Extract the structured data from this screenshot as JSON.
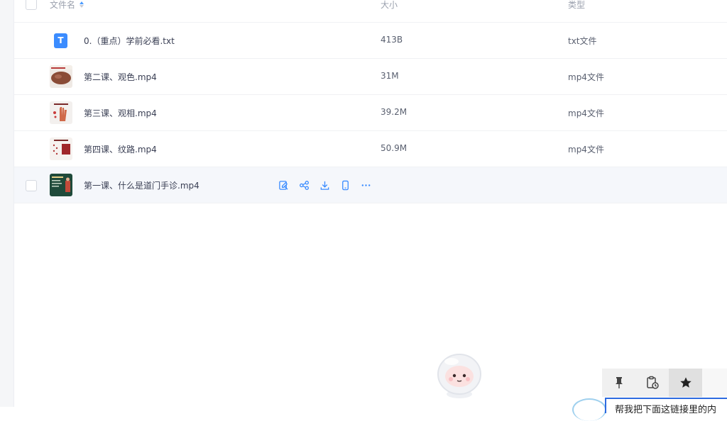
{
  "header": {
    "name_label": "文件名",
    "size_label": "大小",
    "type_label": "类型"
  },
  "files": [
    {
      "name": "0.（重点）学前必看.txt",
      "size": "413B",
      "type": "txt文件",
      "icon": "txt-file-icon",
      "icon_letter": "T"
    },
    {
      "name": "第二课、观色.mp4",
      "size": "31M",
      "type": "mp4文件",
      "icon": "video-thumbnail"
    },
    {
      "name": "第三课、观相.mp4",
      "size": "39.2M",
      "type": "mp4文件",
      "icon": "video-thumbnail"
    },
    {
      "name": "第四课、纹路.mp4",
      "size": "50.9M",
      "type": "mp4文件",
      "icon": "video-thumbnail"
    },
    {
      "name": "第一课、什么是道门手诊.mp4",
      "size": "",
      "type": "",
      "icon": "video-thumbnail",
      "hovered": true
    }
  ],
  "row_actions": [
    "edit-icon",
    "share-icon",
    "download-icon",
    "phone-icon",
    "more-icon"
  ],
  "floating_toolbar": [
    "pin-icon",
    "clipboard-history-icon",
    "star-icon"
  ],
  "input_partial_text": "帮我把下面这链接里的内",
  "colors": {
    "accent": "#3b8cff",
    "hover_row": "#f5f7fb",
    "txt_icon": "#3b8cff"
  }
}
